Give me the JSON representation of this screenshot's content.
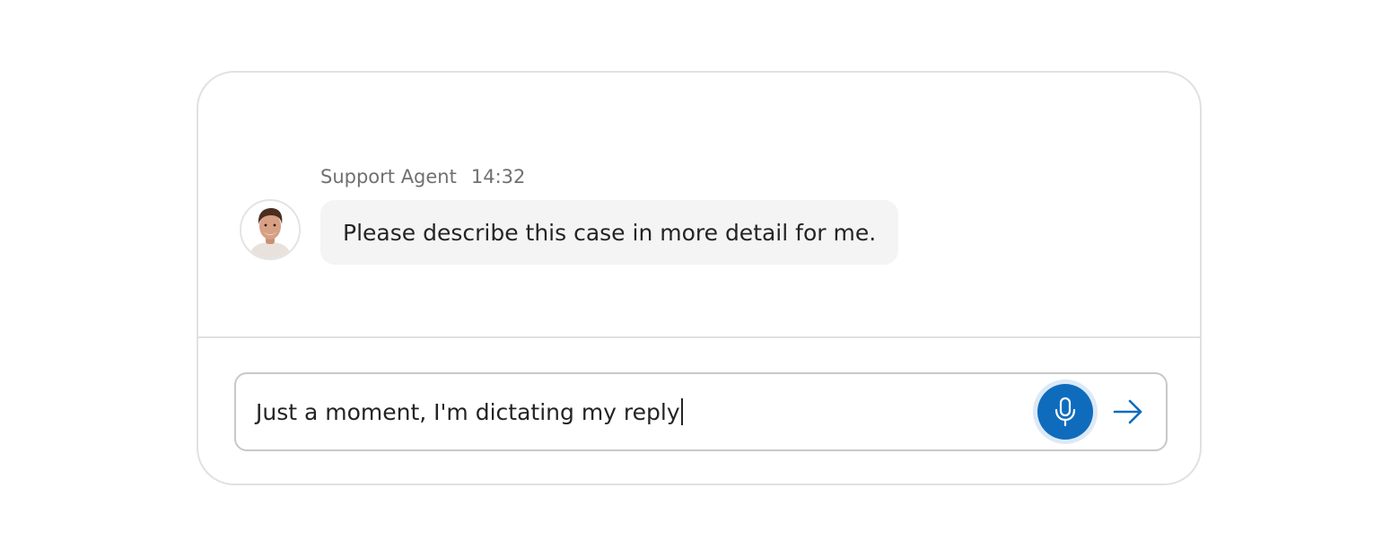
{
  "message": {
    "sender": "Support Agent",
    "time": "14:32",
    "text": "Please describe this case in more detail for me.",
    "avatar_icon": "person-portrait"
  },
  "composer": {
    "value": "Just a moment, I'm dictating my reply",
    "mic_icon": "microphone-icon",
    "mic_state": "active",
    "send_icon": "arrow-right-icon"
  },
  "colors": {
    "accent": "#0f6cbd",
    "mic_halo": "#dce9f7",
    "bubble_bg": "#f4f4f4",
    "border": "#e1e1e1"
  }
}
